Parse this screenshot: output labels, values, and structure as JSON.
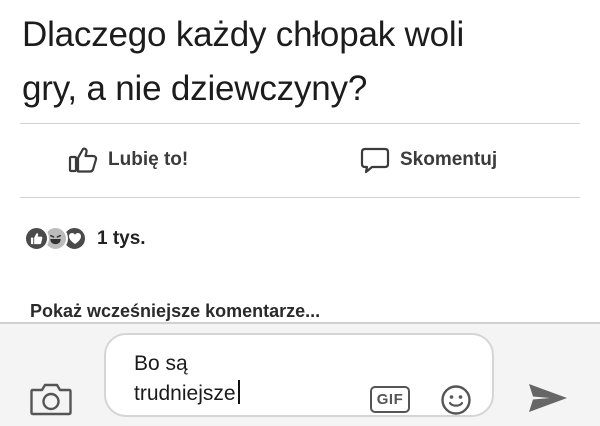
{
  "post": {
    "text_line1": "Dlaczego każdy chłopak woli",
    "text_line2": "gry, a nie dziewczyny?"
  },
  "actions": {
    "like_label": "Lubię to!",
    "comment_label": "Skomentuj"
  },
  "reactions": {
    "icons": [
      "like-icon",
      "haha-icon",
      "love-icon"
    ],
    "count": "1 tys."
  },
  "comments": {
    "show_earlier": "Pokaż wcześniejsze komentarze..."
  },
  "composer": {
    "text_line1": "Bo są",
    "text_line2": "trudniejsze",
    "gif_label": "GIF"
  }
}
